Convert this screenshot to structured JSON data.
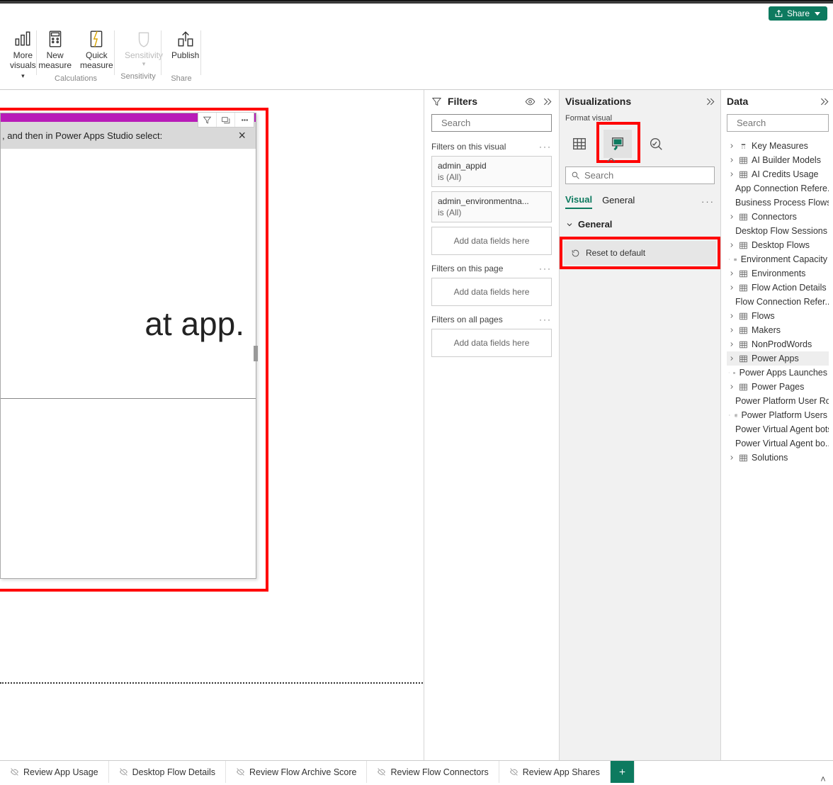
{
  "titlebar": {
    "share": "Share"
  },
  "ribbon": {
    "items": [
      {
        "label1": "More",
        "label2": "visuals"
      },
      {
        "label1": "New",
        "label2": "measure"
      },
      {
        "label1": "Quick",
        "label2": "measure"
      },
      {
        "label1": "Sensitivity",
        "label2": ""
      },
      {
        "label1": "Publish",
        "label2": ""
      }
    ],
    "groups": {
      "calculations": "Calculations",
      "sensitivity": "Sensitivity",
      "share": "Share"
    }
  },
  "canvas": {
    "message": ", and then in Power Apps Studio select:",
    "big_text": "at app."
  },
  "filters": {
    "title": "Filters",
    "search_placeholder": "Search",
    "sections": {
      "on_visual": "Filters on this visual",
      "on_page": "Filters on this page",
      "on_all": "Filters on all pages"
    },
    "cards": [
      {
        "name": "admin_appid",
        "status": "is (All)"
      },
      {
        "name": "admin_environmentna...",
        "status": "is (All)"
      }
    ],
    "add_label": "Add data fields here"
  },
  "viz": {
    "title": "Visualizations",
    "subtitle": "Format visual",
    "search_placeholder": "Search",
    "tabs": {
      "visual": "Visual",
      "general": "General"
    },
    "general_section": "General",
    "reset": "Reset to default"
  },
  "data": {
    "title": "Data",
    "search_placeholder": "Search",
    "tables": [
      "Key Measures",
      "AI Builder Models",
      "AI Credits Usage",
      "App Connection Refere...",
      "Business Process Flows",
      "Connectors",
      "Desktop Flow Sessions",
      "Desktop Flows",
      "Environment Capacity",
      "Environments",
      "Flow Action Details",
      "Flow Connection Refer...",
      "Flows",
      "Makers",
      "NonProdWords",
      "Power Apps",
      "Power Apps Launches",
      "Power Pages",
      "Power Platform User Ro...",
      "Power Platform Users",
      "Power Virtual Agent bots",
      "Power Virtual Agent bo...",
      "Solutions"
    ]
  },
  "tabs": [
    "Review App Usage",
    "Desktop Flow Details",
    "Review Flow Archive Score",
    "Review Flow Connectors",
    "Review App Shares"
  ]
}
